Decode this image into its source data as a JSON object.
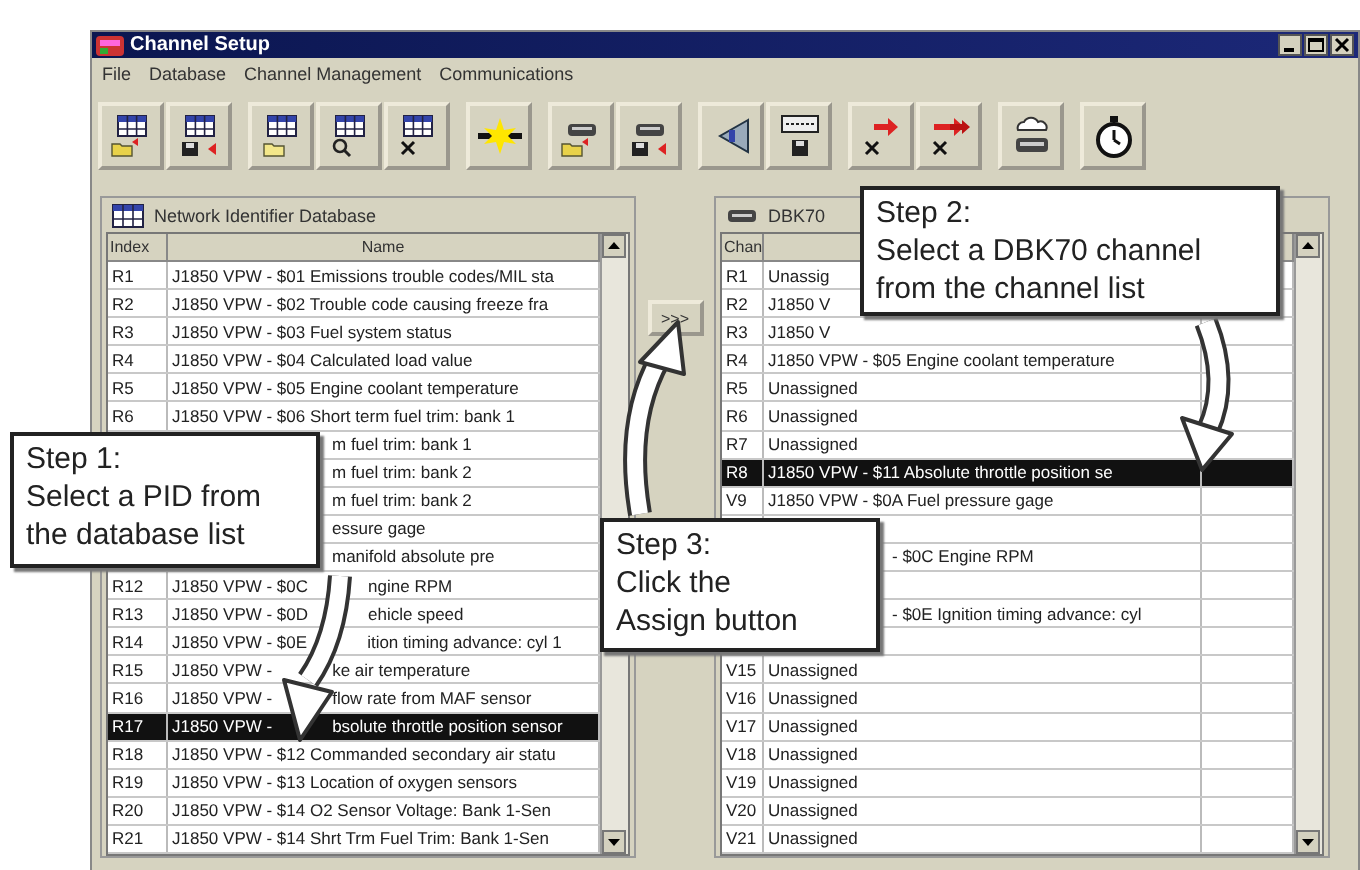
{
  "window": {
    "title": "Channel Setup"
  },
  "menu": [
    "File",
    "Database",
    "Channel Management",
    "Communications"
  ],
  "database_panel": {
    "title": "Network Identifier Database",
    "columns": [
      "Index",
      "Name"
    ],
    "rows": [
      {
        "kind": "plain",
        "index": "R1",
        "name": "J1850 VPW - $01 Emissions trouble codes/MIL sta",
        "selected": false
      },
      {
        "kind": "plain",
        "index": "R2",
        "name": "J1850 VPW - $02 Trouble code causing freeze fra",
        "selected": false
      },
      {
        "kind": "plain",
        "index": "R3",
        "name": "J1850 VPW - $03 Fuel system status",
        "selected": false
      },
      {
        "kind": "plain",
        "index": "R4",
        "name": "J1850 VPW - $04 Calculated load value",
        "selected": false
      },
      {
        "kind": "plain",
        "index": "R5",
        "name": "J1850 VPW - $05 Engine coolant temperature",
        "selected": false
      },
      {
        "kind": "plain",
        "index": "R6",
        "name": "J1850 VPW - $06 Short term fuel trim: bank 1",
        "selected": false
      },
      {
        "kind": "covered",
        "name": "m fuel trim: bank 1",
        "selected": false
      },
      {
        "kind": "covered",
        "name": "m fuel trim: bank 2",
        "selected": false
      },
      {
        "kind": "covered",
        "name": "m fuel trim: bank 2",
        "selected": false
      },
      {
        "kind": "covered",
        "name": "essure gage",
        "selected": false
      },
      {
        "kind": "covered",
        "name": "manifold absolute pre",
        "selected": false
      },
      {
        "kind": "split",
        "index": "R12",
        "parts": [
          "J1850 VPW - $0C",
          "ngine RPM"
        ],
        "selected": false
      },
      {
        "kind": "split",
        "index": "R13",
        "parts": [
          "J1850 VPW - $0D",
          "ehicle speed"
        ],
        "selected": false
      },
      {
        "kind": "split",
        "index": "R14",
        "parts": [
          "J1850 VPW - $0E",
          "ition timing advance: cyl 1"
        ],
        "selected": false
      },
      {
        "kind": "split",
        "index": "R15",
        "parts": [
          "J1850 VPW -",
          "ke air temperature"
        ],
        "selected": false
      },
      {
        "kind": "split",
        "index": "R16",
        "parts": [
          "J1850 VPW -",
          "flow rate from MAF sensor"
        ],
        "selected": false
      },
      {
        "kind": "split",
        "index": "R17",
        "parts": [
          "J1850 VPW -",
          "bsolute throttle position sensor"
        ],
        "selected": true
      },
      {
        "kind": "plain",
        "index": "R18",
        "name": "J1850 VPW - $12 Commanded secondary air statu",
        "selected": false
      },
      {
        "kind": "plain",
        "index": "R19",
        "name": "J1850 VPW - $13 Location of oxygen sensors",
        "selected": false
      },
      {
        "kind": "plain",
        "index": "R20",
        "name": "J1850 VPW - $14 O2 Sensor Voltage: Bank 1-Sen",
        "selected": false
      },
      {
        "kind": "plain",
        "index": "R21",
        "name": "J1850 VPW - $14 Shrt Trm Fuel Trim: Bank 1-Sen",
        "selected": false
      }
    ]
  },
  "assign_button": ">>>",
  "channel_panel": {
    "title": "DBK70",
    "columns": [
      "Chan"
    ],
    "rows": [
      {
        "kind": "plain",
        "index": "R1",
        "name": "Unassig",
        "selected": false
      },
      {
        "kind": "plain",
        "index": "R2",
        "name": "J1850 V",
        "selected": false
      },
      {
        "kind": "plain",
        "index": "R3",
        "name": "J1850 V",
        "selected": false
      },
      {
        "kind": "plain",
        "index": "R4",
        "name": "J1850 VPW - $05 Engine coolant temperature",
        "selected": false
      },
      {
        "kind": "plain",
        "index": "R5",
        "name": "Unassigned",
        "selected": false
      },
      {
        "kind": "plain",
        "index": "R6",
        "name": "Unassigned",
        "selected": false
      },
      {
        "kind": "plain",
        "index": "R7",
        "name": "Unassigned",
        "selected": false
      },
      {
        "kind": "plain",
        "index": "R8",
        "name": "J1850 VPW - $11 Absolute throttle position se",
        "selected": true
      },
      {
        "kind": "plain",
        "index": "V9",
        "name": "J1850 VPW - $0A Fuel pressure gage",
        "selected": false
      },
      {
        "kind": "hidden",
        "selected": false
      },
      {
        "kind": "covered",
        "name": "- $0C Engine RPM",
        "selected": false
      },
      {
        "kind": "hidden",
        "selected": false
      },
      {
        "kind": "covered",
        "name": "- $0E Ignition timing advance: cyl",
        "selected": false
      },
      {
        "kind": "hidden",
        "selected": false
      },
      {
        "kind": "plain",
        "index": "V15",
        "name": "Unassigned",
        "selected": false
      },
      {
        "kind": "plain",
        "index": "V16",
        "name": "Unassigned",
        "selected": false
      },
      {
        "kind": "plain",
        "index": "V17",
        "name": "Unassigned",
        "selected": false
      },
      {
        "kind": "plain",
        "index": "V18",
        "name": "Unassigned",
        "selected": false
      },
      {
        "kind": "plain",
        "index": "V19",
        "name": "Unassigned",
        "selected": false
      },
      {
        "kind": "plain",
        "index": "V20",
        "name": "Unassigned",
        "selected": false
      },
      {
        "kind": "plain",
        "index": "V21",
        "name": "Unassigned",
        "selected": false
      }
    ]
  },
  "callouts": [
    {
      "text": "Step 1:\nSelect a PID from\nthe database list"
    },
    {
      "text": "Step 2:\nSelect a DBK70 channel\nfrom the channel list"
    },
    {
      "text": "Step 3:\nClick the\nAssign button"
    }
  ]
}
